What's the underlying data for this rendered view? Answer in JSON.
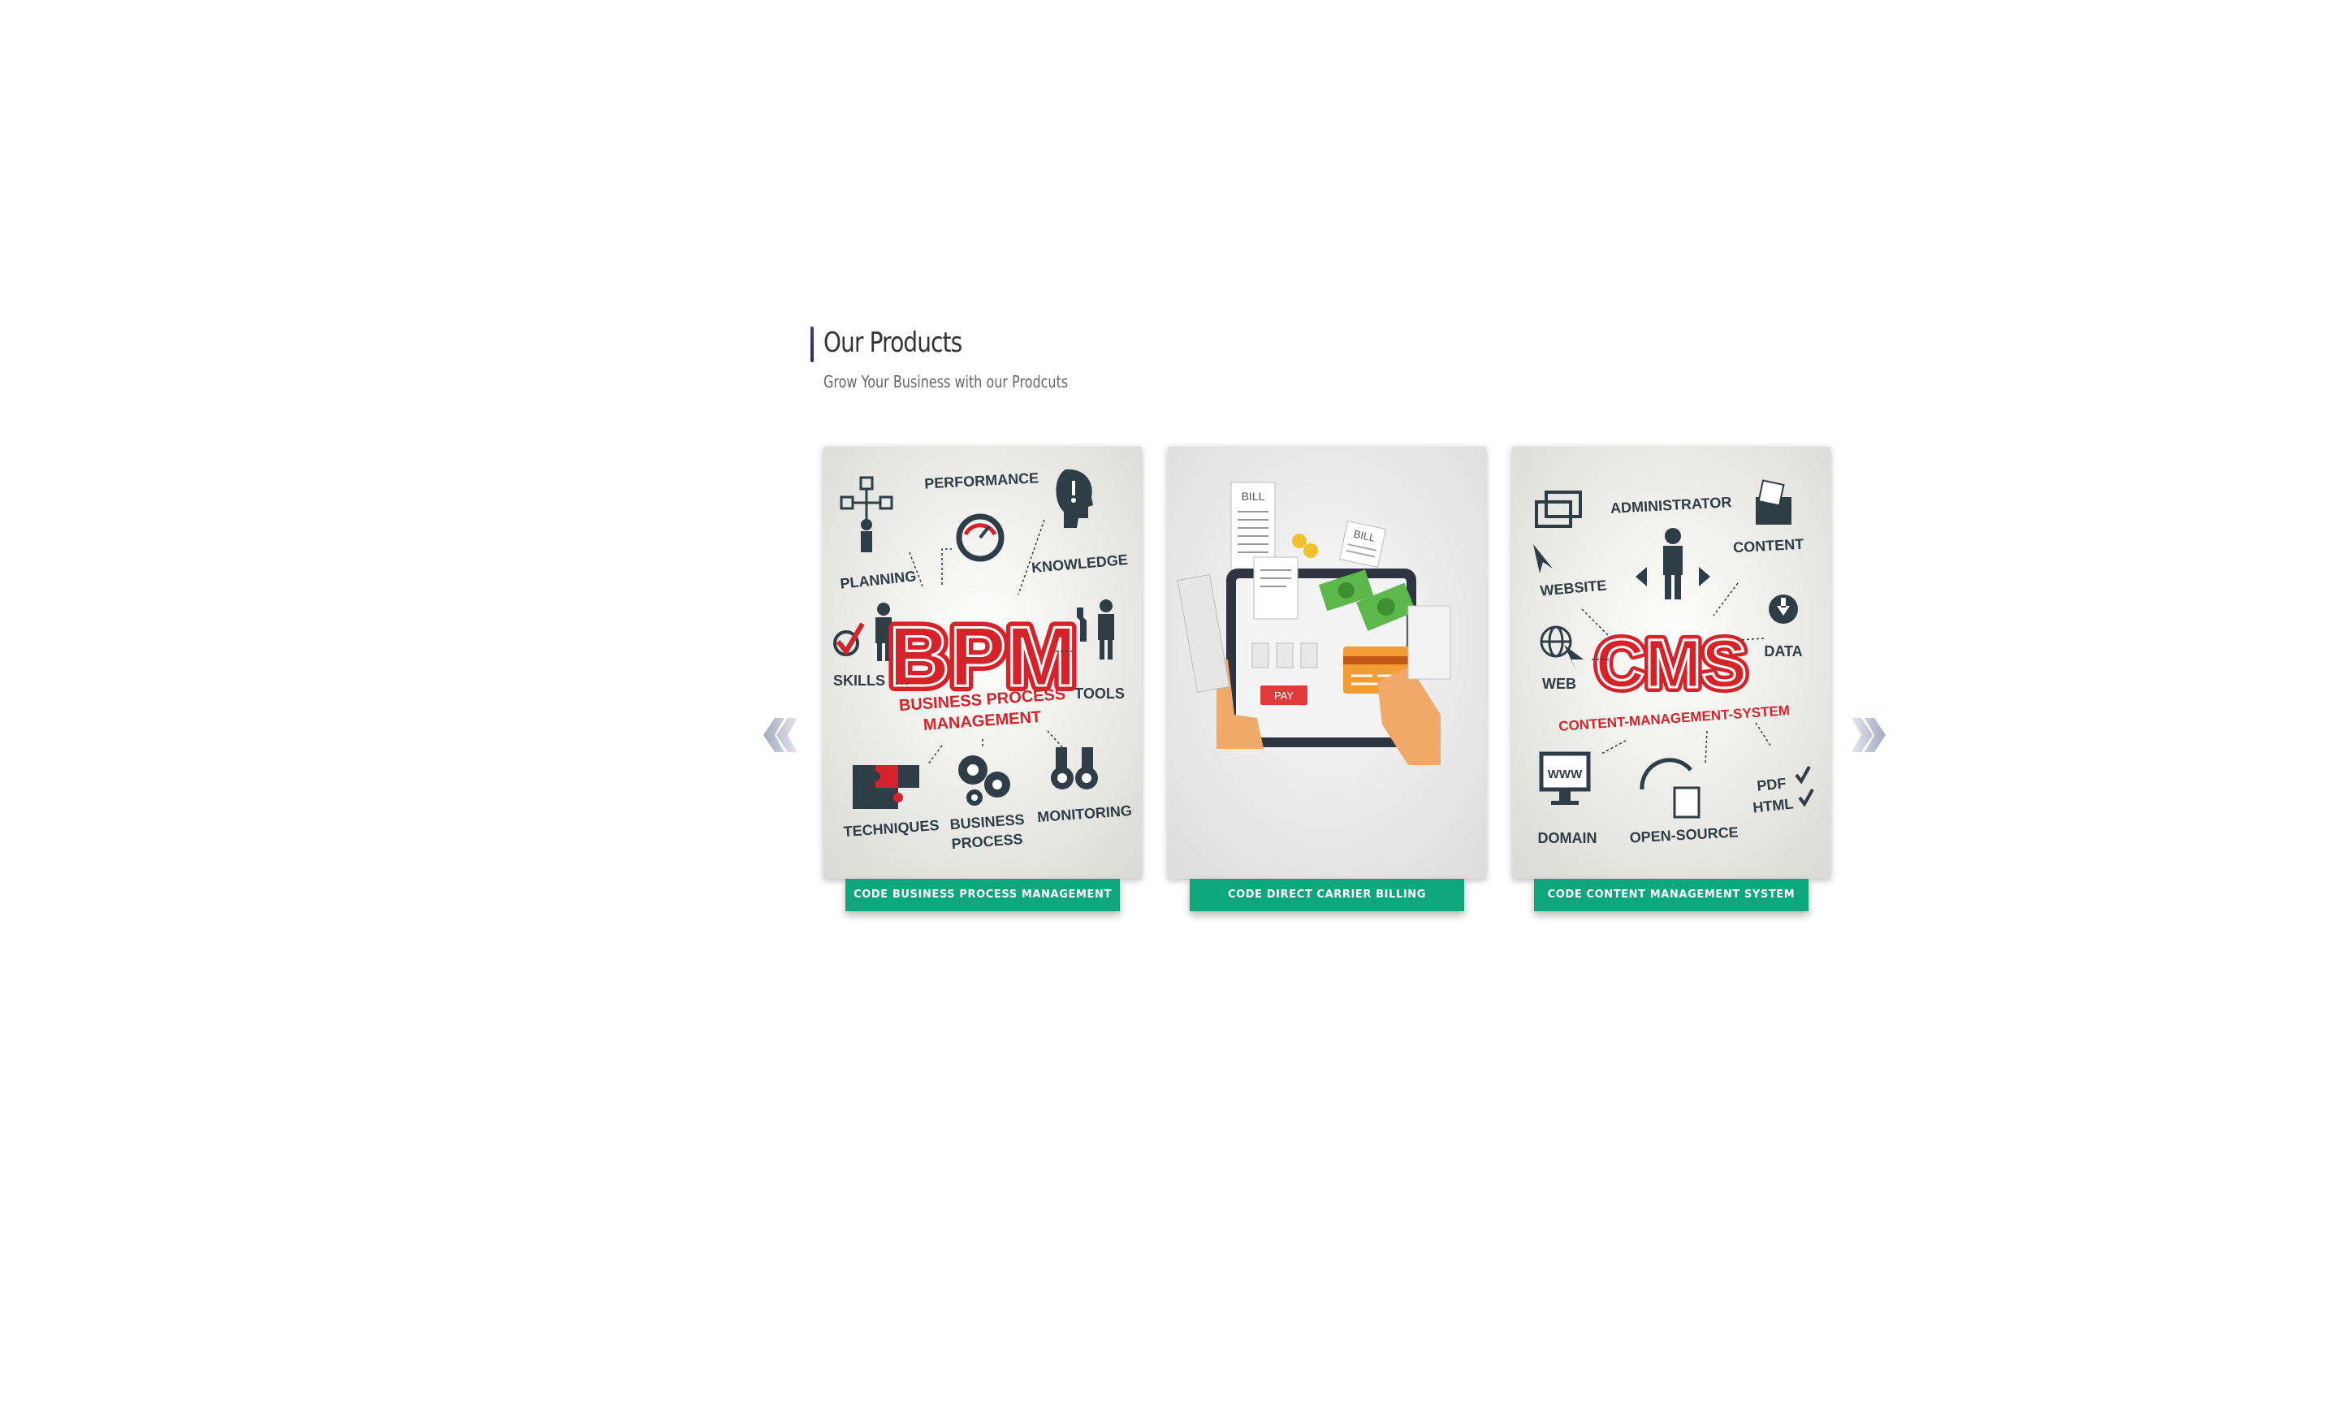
{
  "header": {
    "title": "Our Products",
    "subtitle": "Grow Your Business with our Prodcuts"
  },
  "carousel": {
    "prev_icon": "chevron-left-icon",
    "next_icon": "chevron-right-icon",
    "items": [
      {
        "image": {
          "center": "BPM",
          "caption_line1": "BUSINESS PROCESS",
          "caption_line2": "MANAGEMENT",
          "labels": [
            "PERFORMANCE",
            "PLANNING",
            "KNOWLEDGE",
            "SKILLS",
            "TOOLS",
            "TECHNIQUES",
            "BUSINESS",
            "PROCESS",
            "MONITORING"
          ]
        },
        "button_label": "CODE BUSINESS PROCESS MANAGEMENT"
      },
      {
        "image": {
          "bill_label": "BILL",
          "bill_label_2": "BILL",
          "pay_label": "PAY"
        },
        "button_label": "CODE DIRECT CARRIER BILLING"
      },
      {
        "image": {
          "center": "CMS",
          "caption": "CONTENT-MANAGEMENT-SYSTEM",
          "labels": [
            "ADMINISTRATOR",
            "WEBSITE",
            "CONTENT",
            "DATA",
            "WEB",
            "WWW",
            "DOMAIN",
            "OPEN-SOURCE",
            "PDF",
            "HTML"
          ]
        },
        "button_label": "CODE CONTENT MANAGEMENT SYSTEM"
      }
    ]
  },
  "colors": {
    "accent_button": "#0ea77c",
    "headline_red": "#d6232a",
    "icon_dark": "#2f3d47",
    "title_bar": "#2a2d5e"
  }
}
